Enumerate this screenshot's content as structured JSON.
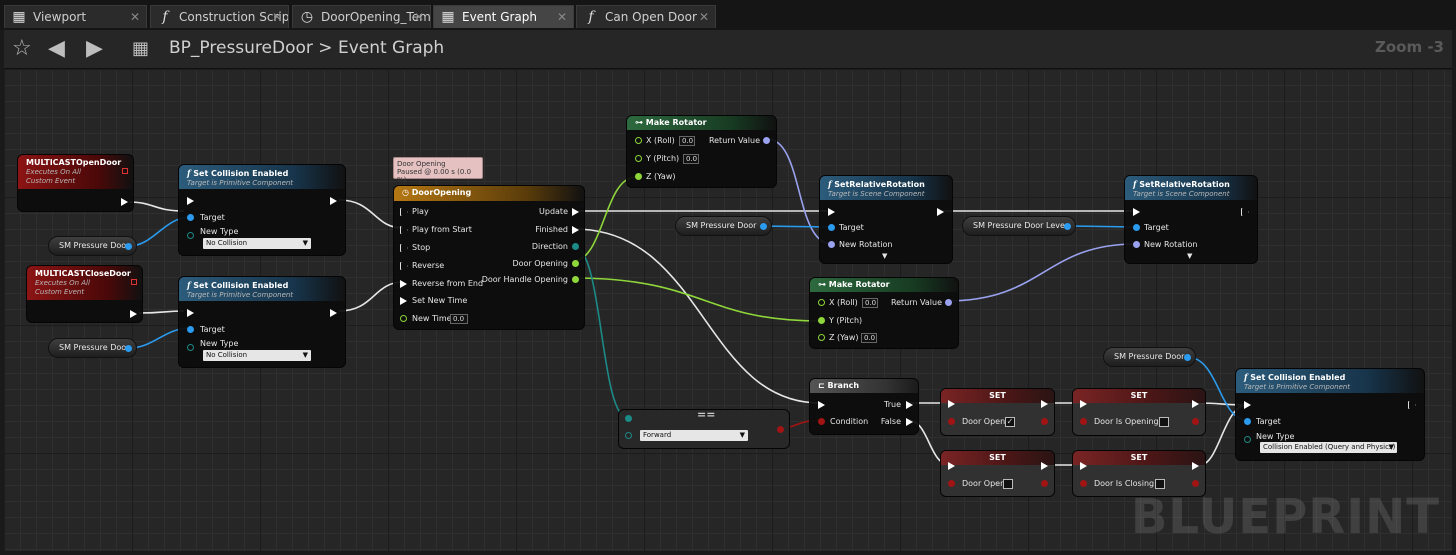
{
  "tabs": [
    {
      "label": "Viewport",
      "icon": "viewport-icon"
    },
    {
      "label": "Construction Scrip",
      "icon": "function-icon"
    },
    {
      "label": "DoorOpening_Tem",
      "icon": "timeline-icon"
    },
    {
      "label": "Event Graph",
      "icon": "graph-icon"
    },
    {
      "label": "Can Open Door",
      "icon": "function-icon"
    }
  ],
  "toolbar": {
    "breadcrumb_root": "BP_PressureDoor",
    "breadcrumb_sep": ">",
    "breadcrumb_leaf": "Event Graph",
    "zoom": "Zoom -3"
  },
  "watermark": "BLUEPRINT",
  "nodes": {
    "open_event": {
      "title": "MULTICASTOpenDoor",
      "sub1": "Executes On All",
      "sub2": "Custom Event"
    },
    "close_event": {
      "title": "MULTICASTCloseDoor",
      "sub1": "Executes On All",
      "sub2": "Custom Event"
    },
    "collision1": {
      "title": "Set Collision Enabled",
      "sub": "Target is Primitive Component",
      "target": "Target",
      "newtype": "New Type",
      "value": "No Collision"
    },
    "collision2": {
      "title": "Set Collision Enabled",
      "sub": "Target is Primitive Component",
      "target": "Target",
      "newtype": "New Type",
      "value": "No Collision"
    },
    "timeline": {
      "title": "DoorOpening",
      "tooltip1": "Door Opening",
      "tooltip2": "Paused @ 0.00 s (0.0 %)",
      "inputs": [
        "Play",
        "Play from Start",
        "Stop",
        "Reverse",
        "Reverse from End",
        "Set New Time",
        "New Time"
      ],
      "new_time": "0.0",
      "outputs": [
        "Update",
        "Finished",
        "Direction",
        "Door Opening",
        "Door Handle Opening"
      ]
    },
    "rotator1": {
      "title": "Make Rotator",
      "x": "X (Roll)",
      "y": "Y (Pitch)",
      "z": "Z (Yaw)",
      "xv": "0.0",
      "yv": "0.0",
      "ret": "Return Value"
    },
    "rotator2": {
      "title": "Make Rotator",
      "x": "X (Roll)",
      "y": "Y (Pitch)",
      "z": "Z (Yaw)",
      "xv": "0.0",
      "zv": "0.0",
      "ret": "Return Value"
    },
    "rel_rot1": {
      "title": "SetRelativeRotation",
      "sub": "Target is Scene Component",
      "target": "Target",
      "newrot": "New Rotation"
    },
    "rel_rot2": {
      "title": "SetRelativeRotation",
      "sub": "Target is Scene Component",
      "target": "Target",
      "newrot": "New Rotation"
    },
    "branch": {
      "title": "Branch",
      "cond": "Condition",
      "t": "True",
      "f": "False"
    },
    "enum_eq": {
      "op": "==",
      "value": "Forward"
    },
    "set1": {
      "title": "SET",
      "label": "Door Open",
      "checked": true,
      "mark": "✓"
    },
    "set2": {
      "title": "SET",
      "label": "Door Is Opening",
      "checked": false
    },
    "set3": {
      "title": "SET",
      "label": "Door Open",
      "checked": false
    },
    "set4": {
      "title": "SET",
      "label": "Door Is Closing",
      "checked": false
    },
    "collision3": {
      "title": "Set Collision Enabled",
      "sub": "Target is Primitive Component",
      "target": "Target",
      "newtype": "New Type",
      "value": "Collision Enabled (Query and Physics)"
    }
  },
  "vars": {
    "door1": "SM Pressure Door",
    "door2": "SM Pressure Door",
    "door3": "SM Pressure Door",
    "door4": "SM Pressure Door",
    "lever": "SM Pressure Door Lever"
  },
  "colors": {
    "exec": "#ffffff",
    "object": "#2a9bee",
    "float": "#8ed63a",
    "rotator": "#9aa2ef",
    "bool": "#a11414",
    "enum": "#1c8a86"
  }
}
